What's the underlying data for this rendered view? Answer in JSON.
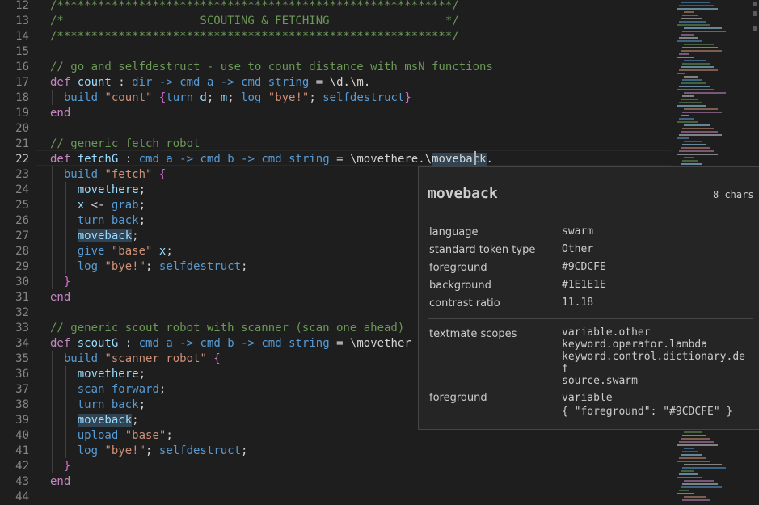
{
  "editor": {
    "active_line": "22",
    "line_numbers": [
      "12",
      "13",
      "14",
      "15",
      "16",
      "17",
      "18",
      "19",
      "20",
      "21",
      "22",
      "23",
      "24",
      "25",
      "26",
      "27",
      "28",
      "29",
      "30",
      "31",
      "32",
      "33",
      "34",
      "35",
      "36",
      "37",
      "38",
      "39",
      "40",
      "41",
      "42",
      "43",
      "44"
    ],
    "colors": {
      "comment": "#6a9955",
      "keyword": "#c586c0",
      "variable": "#9cdcfe",
      "type": "#569cd6",
      "string": "#ce9178",
      "background": "#1e1e1e"
    },
    "lines": [
      [
        {
          "t": "/**********************************************************/",
          "c": "cm"
        }
      ],
      [
        {
          "t": "/*                    SCOUTING & FETCHING                 */",
          "c": "cm"
        }
      ],
      [
        {
          "t": "/**********************************************************/",
          "c": "cm"
        }
      ],
      [],
      [
        {
          "t": "// go and selfdestruct - use to count distance with msN functions",
          "c": "cm"
        }
      ],
      [
        {
          "t": "def ",
          "c": "kw"
        },
        {
          "t": "count",
          "c": "var"
        },
        {
          "t": " : ",
          "c": "op"
        },
        {
          "t": "dir",
          "c": "ty"
        },
        {
          "t": " -> ",
          "c": "ty"
        },
        {
          "t": "cmd",
          "c": "ty"
        },
        {
          "t": " a -> ",
          "c": "ty"
        },
        {
          "t": "cmd",
          "c": "ty"
        },
        {
          "t": " string",
          "c": "ty"
        },
        {
          "t": " = ",
          "c": "op"
        },
        {
          "t": "\\d",
          "c": "op"
        },
        {
          "t": ".",
          "c": "op"
        },
        {
          "t": "\\m",
          "c": "op"
        },
        {
          "t": ".",
          "c": "op"
        }
      ],
      [
        {
          "t": "  build ",
          "c": "ty"
        },
        {
          "t": "\"count\"",
          "c": "str"
        },
        {
          "t": " {",
          "c": "br"
        },
        {
          "t": "turn",
          "c": "ty"
        },
        {
          "t": " d",
          "c": "var"
        },
        {
          "t": "; ",
          "c": "op"
        },
        {
          "t": "m",
          "c": "var"
        },
        {
          "t": "; ",
          "c": "op"
        },
        {
          "t": "log",
          "c": "ty"
        },
        {
          "t": " \"bye!\"",
          "c": "str"
        },
        {
          "t": "; ",
          "c": "op"
        },
        {
          "t": "selfdestruct",
          "c": "ty"
        },
        {
          "t": "}",
          "c": "br"
        }
      ],
      [
        {
          "t": "end",
          "c": "kw"
        }
      ],
      [],
      [
        {
          "t": "// generic fetch robot",
          "c": "cm"
        }
      ],
      [
        {
          "t": "def ",
          "c": "kw"
        },
        {
          "t": "fetchG",
          "c": "var"
        },
        {
          "t": " : ",
          "c": "op"
        },
        {
          "t": "cmd",
          "c": "ty"
        },
        {
          "t": " a -> ",
          "c": "ty"
        },
        {
          "t": "cmd",
          "c": "ty"
        },
        {
          "t": " b -> ",
          "c": "ty"
        },
        {
          "t": "cmd",
          "c": "ty"
        },
        {
          "t": " string",
          "c": "ty"
        },
        {
          "t": " = ",
          "c": "op"
        },
        {
          "t": "\\movethere.\\",
          "c": "op"
        },
        {
          "t": "moveback",
          "c": "op hl"
        },
        {
          "t": ".",
          "c": "op"
        }
      ],
      [
        {
          "t": "  build ",
          "c": "ty"
        },
        {
          "t": "\"fetch\"",
          "c": "str"
        },
        {
          "t": " {",
          "c": "br"
        }
      ],
      [
        {
          "t": "    movethere",
          "c": "var"
        },
        {
          "t": ";",
          "c": "op"
        }
      ],
      [
        {
          "t": "    x",
          "c": "var"
        },
        {
          "t": " <- ",
          "c": "op"
        },
        {
          "t": "grab",
          "c": "ty"
        },
        {
          "t": ";",
          "c": "op"
        }
      ],
      [
        {
          "t": "    turn",
          "c": "ty"
        },
        {
          "t": " back",
          "c": "ty"
        },
        {
          "t": ";",
          "c": "op"
        }
      ],
      [
        {
          "t": "    ",
          "c": "op"
        },
        {
          "t": "moveback",
          "c": "var hl"
        },
        {
          "t": ";",
          "c": "op"
        }
      ],
      [
        {
          "t": "    give",
          "c": "ty"
        },
        {
          "t": " \"base\"",
          "c": "str"
        },
        {
          "t": " x",
          "c": "var"
        },
        {
          "t": ";",
          "c": "op"
        }
      ],
      [
        {
          "t": "    log",
          "c": "ty"
        },
        {
          "t": " \"bye!\"",
          "c": "str"
        },
        {
          "t": "; ",
          "c": "op"
        },
        {
          "t": "selfdestruct",
          "c": "ty"
        },
        {
          "t": ";",
          "c": "op"
        }
      ],
      [
        {
          "t": "  }",
          "c": "br"
        }
      ],
      [
        {
          "t": "end",
          "c": "kw"
        }
      ],
      [],
      [
        {
          "t": "// generic scout robot with scanner (scan one ahead)",
          "c": "cm"
        }
      ],
      [
        {
          "t": "def ",
          "c": "kw"
        },
        {
          "t": "scoutG",
          "c": "var"
        },
        {
          "t": " : ",
          "c": "op"
        },
        {
          "t": "cmd",
          "c": "ty"
        },
        {
          "t": " a -> ",
          "c": "ty"
        },
        {
          "t": "cmd",
          "c": "ty"
        },
        {
          "t": " b -> ",
          "c": "ty"
        },
        {
          "t": "cmd",
          "c": "ty"
        },
        {
          "t": " string",
          "c": "ty"
        },
        {
          "t": " = ",
          "c": "op"
        },
        {
          "t": "\\movether",
          "c": "op"
        }
      ],
      [
        {
          "t": "  build ",
          "c": "ty"
        },
        {
          "t": "\"scanner robot\"",
          "c": "str"
        },
        {
          "t": " {",
          "c": "br"
        }
      ],
      [
        {
          "t": "    movethere",
          "c": "var"
        },
        {
          "t": ";",
          "c": "op"
        }
      ],
      [
        {
          "t": "    scan",
          "c": "ty"
        },
        {
          "t": " forward",
          "c": "ty"
        },
        {
          "t": ";",
          "c": "op"
        }
      ],
      [
        {
          "t": "    turn",
          "c": "ty"
        },
        {
          "t": " back",
          "c": "ty"
        },
        {
          "t": ";",
          "c": "op"
        }
      ],
      [
        {
          "t": "    ",
          "c": "op"
        },
        {
          "t": "moveback",
          "c": "var hl"
        },
        {
          "t": ";",
          "c": "op"
        }
      ],
      [
        {
          "t": "    upload",
          "c": "ty"
        },
        {
          "t": " \"base\"",
          "c": "str"
        },
        {
          "t": ";",
          "c": "op"
        }
      ],
      [
        {
          "t": "    log",
          "c": "ty"
        },
        {
          "t": " \"bye!\"",
          "c": "str"
        },
        {
          "t": "; ",
          "c": "op"
        },
        {
          "t": "selfdestruct",
          "c": "ty"
        },
        {
          "t": ";",
          "c": "op"
        }
      ],
      [
        {
          "t": "  }",
          "c": "br"
        }
      ],
      [
        {
          "t": "end",
          "c": "kw"
        }
      ],
      []
    ]
  },
  "hover": {
    "title": "moveback",
    "chars": "8 chars",
    "rows": [
      {
        "key": "language",
        "value": "swarm"
      },
      {
        "key": "standard token type",
        "value": "Other"
      },
      {
        "key": "foreground",
        "value": "#9CDCFE"
      },
      {
        "key": "background",
        "value": "#1E1E1E"
      },
      {
        "key": "contrast ratio",
        "value": "11.18"
      }
    ],
    "scopes_key": "textmate scopes",
    "scopes": [
      "variable.other",
      "keyword.operator.lambda",
      "keyword.control.dictionary.de",
      "f",
      "source.swarm"
    ],
    "fg_key": "foreground",
    "fg_values": [
      "variable",
      "{ \"foreground\": \"#9CDCFE\" }"
    ]
  }
}
